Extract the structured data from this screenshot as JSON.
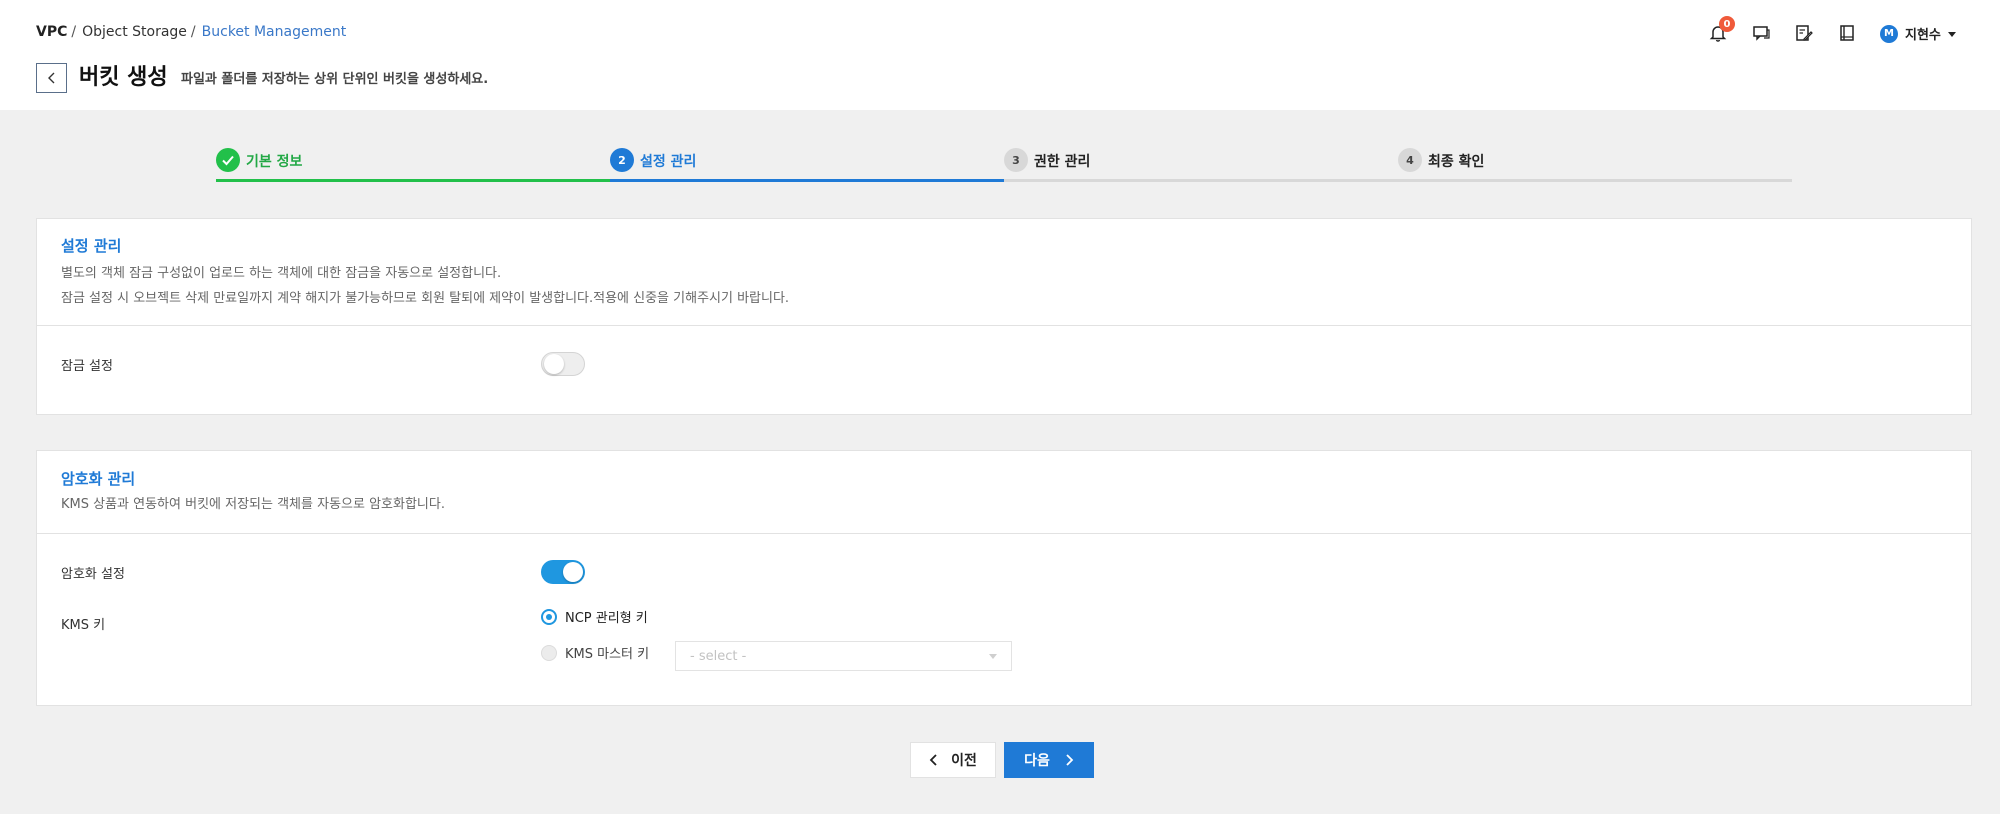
{
  "breadcrumb": {
    "root": "VPC",
    "middle": "Object Storage",
    "current": "Bucket Management",
    "separator": "/"
  },
  "page": {
    "title": "버킷 생성",
    "description": "파일과 폴더를 저장하는 상위 단위인 버킷을 생성하세요."
  },
  "header": {
    "notification_count": "0",
    "user_initial": "M",
    "user_name": "지현수"
  },
  "steps": [
    {
      "number": "1",
      "label": "기본 정보",
      "status": "done"
    },
    {
      "number": "2",
      "label": "설정 관리",
      "status": "active"
    },
    {
      "number": "3",
      "label": "권한 관리",
      "status": "pending"
    },
    {
      "number": "4",
      "label": "최종 확인",
      "status": "pending"
    }
  ],
  "lock_panel": {
    "title": "설정 관리",
    "desc1": "별도의 객체 잠금 구성없이 업로드 하는 객체에 대한 잠금을 자동으로 설정합니다.",
    "desc2": "잠금 설정 시 오브젝트 삭제 만료일까지 계약 해지가 불가능하므로 회원 탈퇴에 제약이 발생합니다.적용에 신중을 기해주시기 바랍니다.",
    "lock_label": "잠금 설정",
    "lock_enabled": false
  },
  "encryption_panel": {
    "title": "암호화 관리",
    "desc": "KMS 상품과 연동하여 버킷에 저장되는 객체를 자동으로 암호화합니다.",
    "encryption_label": "암호화 설정",
    "encryption_enabled": true,
    "kms_label": "KMS 키",
    "option_ncp": "NCP 관리형 키",
    "option_kms": "KMS 마스터 키",
    "selected_option": "NCP 관리형 키",
    "select_placeholder": "- select -"
  },
  "footer": {
    "prev_label": "이전",
    "next_label": "다음"
  },
  "colors": {
    "primary": "#1f7ad6",
    "success": "#22c04a",
    "toggle_on": "#1f97e0",
    "badge": "#f05a3a"
  }
}
